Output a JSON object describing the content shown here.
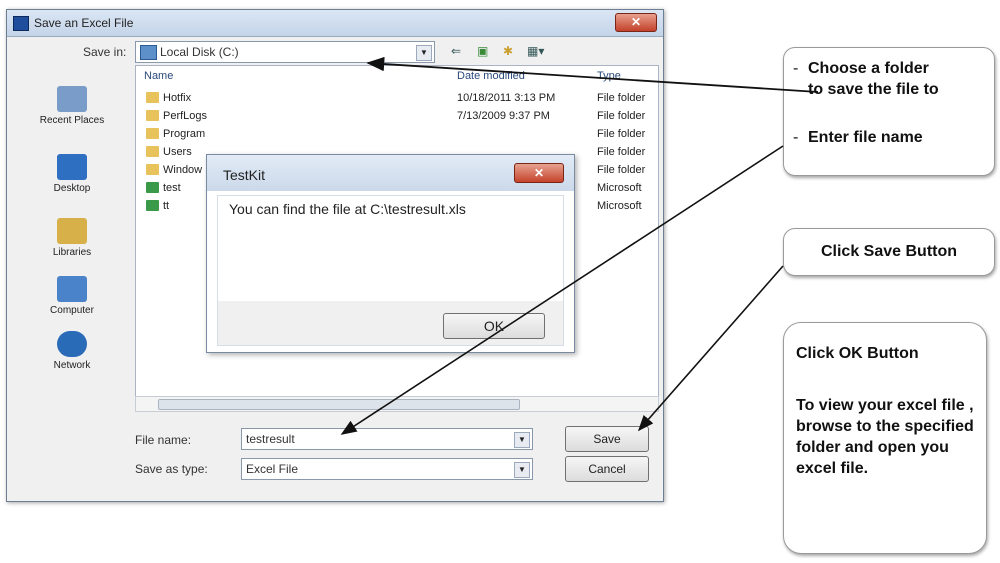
{
  "dialog": {
    "title": "Save an Excel File",
    "close_glyph": "✕",
    "save_in_label": "Save in:",
    "save_in_value": "Local Disk (C:)",
    "toolbar_glyphs": [
      "⇐",
      "▣",
      "✱",
      "▦▾"
    ],
    "places": [
      {
        "label": "Recent Places",
        "icon": "recent-places-icon",
        "color": "#7a9cc8"
      },
      {
        "label": "Desktop",
        "icon": "desktop-icon",
        "color": "#2f6fc2"
      },
      {
        "label": "Libraries",
        "icon": "libraries-icon",
        "color": "#d8b04a"
      },
      {
        "label": "Computer",
        "icon": "computer-icon",
        "color": "#4a83c9"
      },
      {
        "label": "Network",
        "icon": "network-icon",
        "color": "#2a6bb8"
      }
    ],
    "columns": {
      "name": "Name",
      "date": "Date modified",
      "type": "Type"
    },
    "files": [
      {
        "name": "Hotfix",
        "date": "10/18/2011 3:13 PM",
        "type": "File folder",
        "icon": "folder-icon",
        "color": "#e8c25a"
      },
      {
        "name": "PerfLogs",
        "date": "7/13/2009 9:37 PM",
        "type": "File folder",
        "icon": "folder-icon",
        "color": "#e8c25a"
      },
      {
        "name": "Program",
        "date": "",
        "type": "File folder",
        "icon": "folder-icon",
        "color": "#e8c25a"
      },
      {
        "name": "Users",
        "date": "",
        "type": "File folder",
        "icon": "folder-icon",
        "color": "#e8c25a"
      },
      {
        "name": "Window",
        "date": "",
        "type": "File folder",
        "icon": "folder-icon",
        "color": "#e8c25a"
      },
      {
        "name": "test",
        "date": "",
        "type": "Microsoft",
        "icon": "excel-file-icon",
        "color": "#3a9a4a"
      },
      {
        "name": "tt",
        "date": "",
        "type": "Microsoft",
        "icon": "excel-file-icon",
        "color": "#3a9a4a"
      }
    ],
    "file_name_label": "File name:",
    "file_name_value": "testresult",
    "save_type_label": "Save as type:",
    "save_type_value": "Excel File",
    "save_button": "Save",
    "cancel_button": "Cancel"
  },
  "message_box": {
    "title": "TestKit",
    "close_glyph": "✕",
    "text": "You can find the file at  C:\\testresult.xls",
    "ok_button": "OK"
  },
  "callouts": {
    "folder_line1": "Choose a folder",
    "folder_line2": "to save the file to",
    "filename": "Enter file name",
    "save": "Click Save Button",
    "ok_title": "Click OK Button",
    "ok_body": "To view your excel file , browse to the specified folder and open you excel file."
  }
}
